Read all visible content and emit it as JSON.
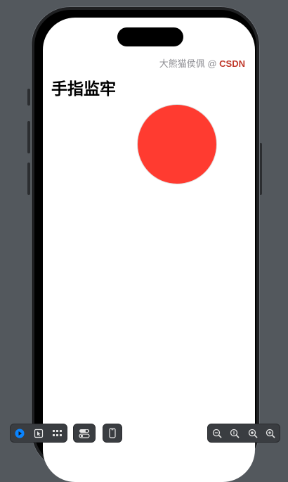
{
  "app": {
    "watermark": {
      "prefix": "大熊猫侯佩 @ ",
      "brand": "CSDN"
    },
    "title": "手指监牢"
  },
  "colors": {
    "canvas": "#53585d",
    "dot": "#ff3b30",
    "brand": "#c0392b",
    "accent": "#0a84ff"
  },
  "toolbar": {
    "left": [
      {
        "icon": "live-preview-icon",
        "active": true
      },
      {
        "icon": "selectable-cursor-icon"
      },
      {
        "icon": "variants-grid-icon"
      }
    ],
    "middle": [
      {
        "icon": "settings-toggle-icon"
      }
    ],
    "device": [
      {
        "icon": "device-phone-icon"
      }
    ],
    "right": [
      {
        "icon": "zoom-out-icon"
      },
      {
        "icon": "zoom-to-100-icon"
      },
      {
        "icon": "zoom-to-fit-icon"
      },
      {
        "icon": "zoom-in-icon"
      }
    ]
  }
}
